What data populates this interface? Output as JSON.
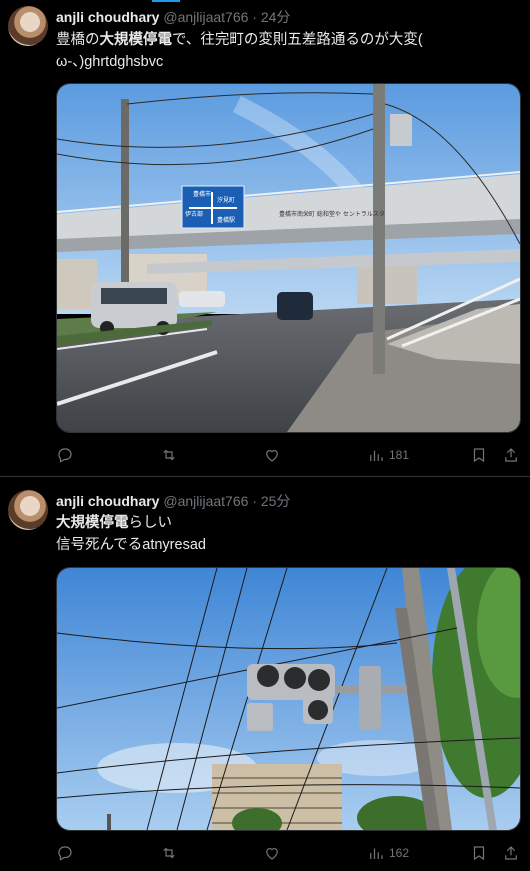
{
  "posts": [
    {
      "author_name": "anjli choudhary",
      "handle": "@anjlijaat766",
      "separator": "·",
      "time": "24分",
      "line1_a": "豊橋の",
      "line1_b": "大規模停電",
      "line1_c": "で、往完町の変則五差路通るのが大変(",
      "line2": "ω-、)ghrtdghsbvc",
      "views": "181",
      "sign_lines": [
        "豊橋市",
        "伊古部",
        "汐見町",
        "豊橋駅"
      ],
      "bridge_text": "豊橋市南栄町  総和堂や  セントラルスタ"
    },
    {
      "author_name": "anjli choudhary",
      "handle": "@anjlijaat766",
      "separator": "·",
      "time": "25分",
      "line1_a": "大規模停電",
      "line1_b": "らしい",
      "line2": "信号死んでるatnyresad",
      "views": "162"
    }
  ],
  "icons": {
    "reply": "reply-icon",
    "repost": "repost-icon",
    "like": "heart-icon",
    "views": "views-icon",
    "bookmark": "bookmark-icon",
    "share": "share-icon"
  },
  "colors": {
    "background": "#000000",
    "text": "#e7e9ea",
    "secondary": "#71767b",
    "accent": "#1d9bf0",
    "border": "#2f3336"
  }
}
